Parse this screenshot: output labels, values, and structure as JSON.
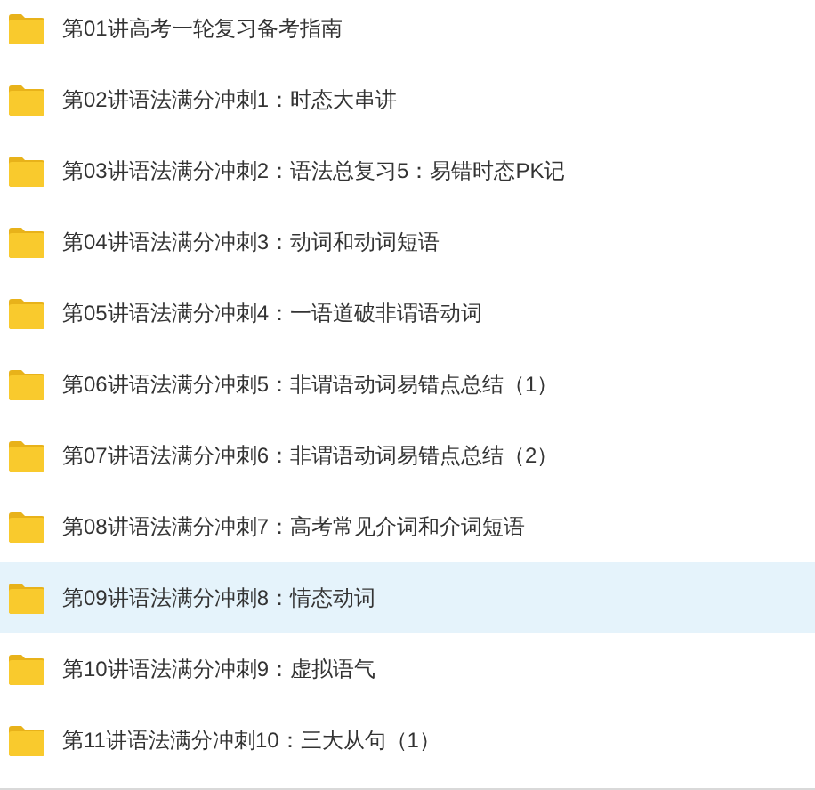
{
  "folders": [
    {
      "name": "第01讲高考一轮复习备考指南",
      "selected": false
    },
    {
      "name": "第02讲语法满分冲刺1：时态大串讲",
      "selected": false
    },
    {
      "name": "第03讲语法满分冲刺2：语法总复习5：易错时态PK记",
      "selected": false
    },
    {
      "name": "第04讲语法满分冲刺3：动词和动词短语",
      "selected": false
    },
    {
      "name": "第05讲语法满分冲刺4：一语道破非谓语动词",
      "selected": false
    },
    {
      "name": "第06讲语法满分冲刺5：非谓语动词易错点总结（1）",
      "selected": false
    },
    {
      "name": "第07讲语法满分冲刺6：非谓语动词易错点总结（2）",
      "selected": false
    },
    {
      "name": "第08讲语法满分冲刺7：高考常见介词和介词短语",
      "selected": false
    },
    {
      "name": "第09讲语法满分冲刺8：情态动词",
      "selected": true
    },
    {
      "name": "第10讲语法满分冲刺9：虚拟语气",
      "selected": false
    },
    {
      "name": "第11讲语法满分冲刺10：三大从句（1）",
      "selected": false
    }
  ]
}
